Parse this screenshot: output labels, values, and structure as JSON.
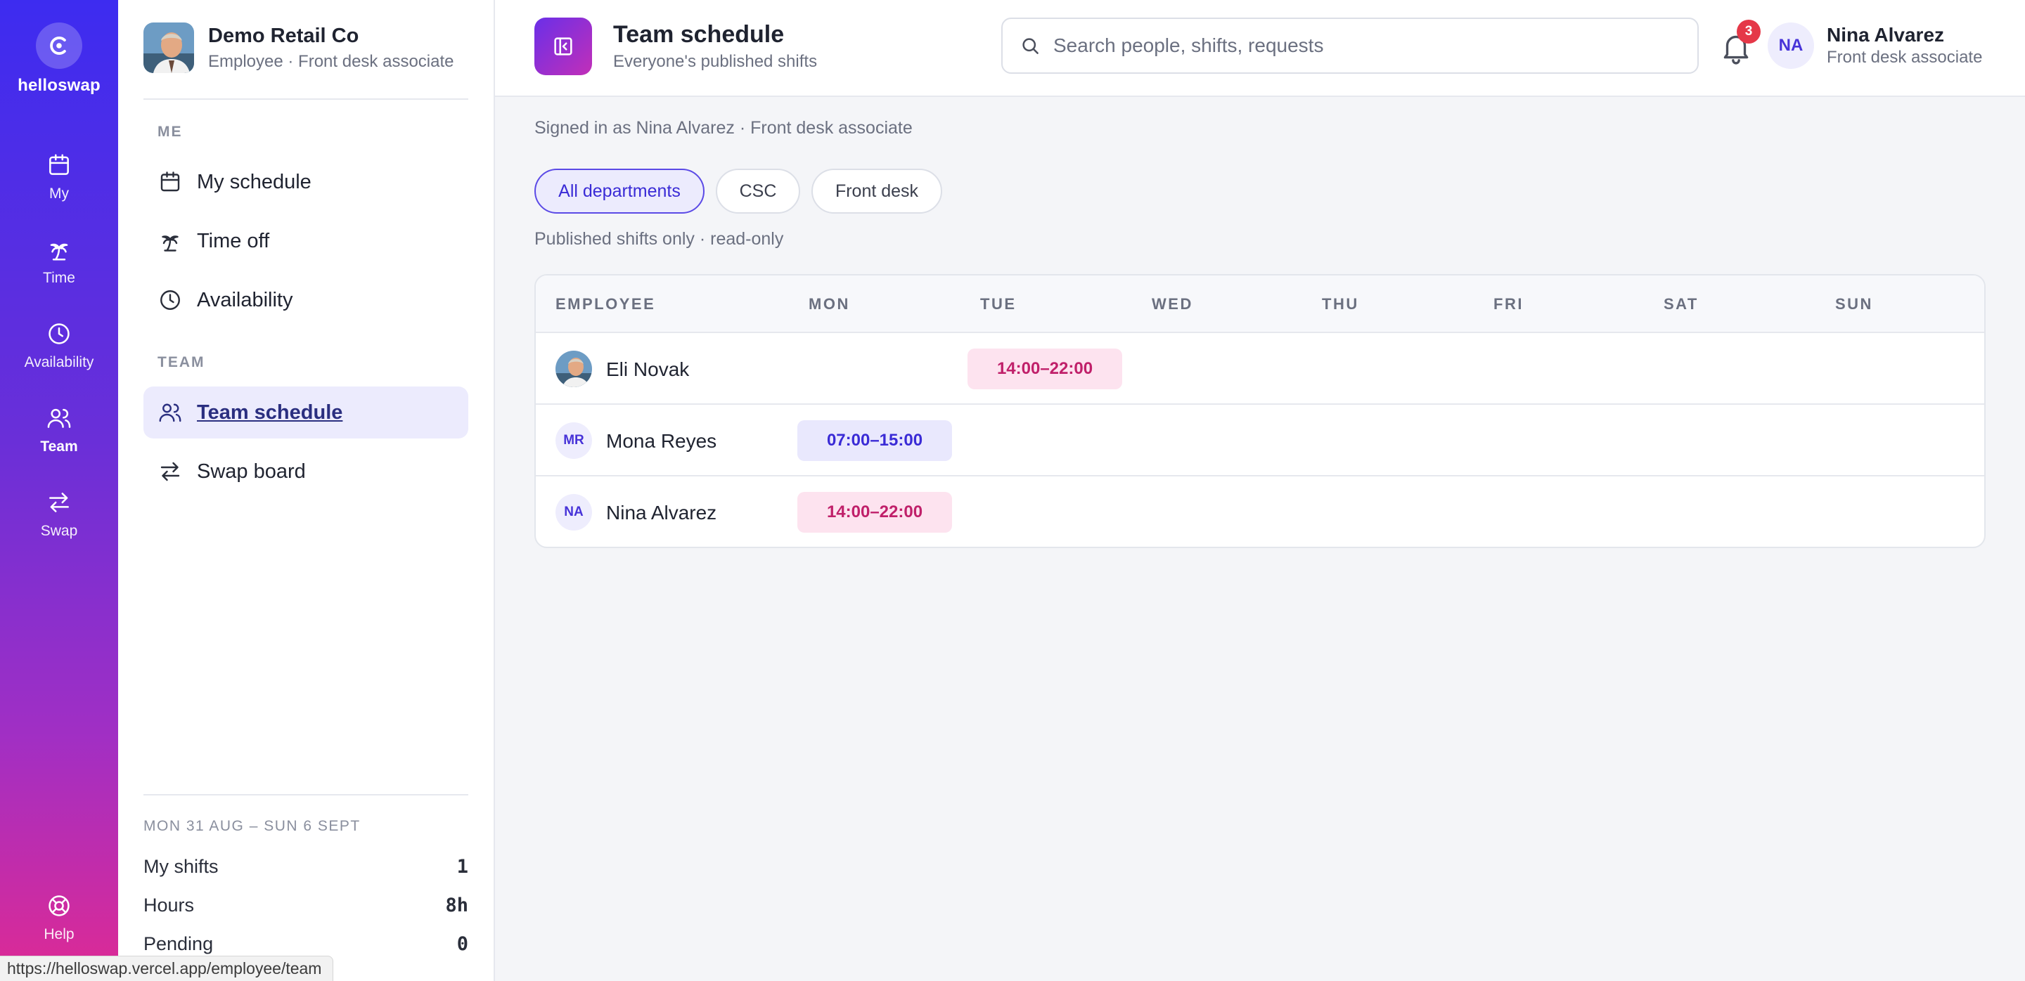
{
  "rail": {
    "brand": "helloswap",
    "items": [
      {
        "label": "My",
        "icon": "calendar-icon"
      },
      {
        "label": "Time",
        "icon": "palm-tree-icon"
      },
      {
        "label": "Availability",
        "icon": "clock-icon"
      },
      {
        "label": "Team",
        "icon": "users-icon"
      },
      {
        "label": "Swap",
        "icon": "swap-arrows-icon"
      }
    ],
    "help_label": "Help",
    "active": "Team"
  },
  "sidebar": {
    "org_name": "Demo Retail Co",
    "org_sub": "Employee · Front desk associate",
    "section_me": "ME",
    "section_team": "TEAM",
    "me_items": [
      {
        "label": "My schedule",
        "icon": "calendar-icon"
      },
      {
        "label": "Time off",
        "icon": "palm-tree-icon"
      },
      {
        "label": "Availability",
        "icon": "clock-icon"
      }
    ],
    "team_items": [
      {
        "label": "Team schedule",
        "icon": "users-icon",
        "active": true
      },
      {
        "label": "Swap board",
        "icon": "swap-arrows-icon"
      }
    ],
    "week_label": "MON 31 AUG – SUN 6 SEPT",
    "stats": [
      {
        "label": "My shifts",
        "value": "1"
      },
      {
        "label": "Hours",
        "value": "8h"
      },
      {
        "label": "Pending",
        "value": "0"
      }
    ]
  },
  "header": {
    "title": "Team schedule",
    "subtitle": "Everyone's published shifts",
    "search_placeholder": "Search people, shifts, requests",
    "notifications": "3",
    "user_initials": "NA",
    "user_name": "Nina Alvarez",
    "user_role": "Front desk associate"
  },
  "main": {
    "signed_in": "Signed in as Nina Alvarez · Front desk associate",
    "filters": [
      "All departments",
      "CSC",
      "Front desk"
    ],
    "active_filter": "All departments",
    "note": "Published shifts only · read-only",
    "columns": [
      "EMPLOYEE",
      "MON",
      "TUE",
      "WED",
      "THU",
      "FRI",
      "SAT",
      "SUN"
    ],
    "rows": [
      {
        "name": "Eli Novak",
        "initials": "",
        "photo": true,
        "shift": {
          "day": "TUE",
          "time": "14:00–22:00",
          "tone": "pink"
        }
      },
      {
        "name": "Mona Reyes",
        "initials": "MR",
        "photo": false,
        "shift": {
          "day": "MON",
          "time": "07:00–15:00",
          "tone": "blue"
        }
      },
      {
        "name": "Nina Alvarez",
        "initials": "NA",
        "photo": false,
        "shift": {
          "day": "MON",
          "time": "14:00–22:00",
          "tone": "pink"
        }
      }
    ]
  },
  "status_bar": {
    "url": "https://helloswap.vercel.app/employee/team"
  },
  "colors": {
    "accent": "#4733d8",
    "shift_pink_bg": "#fde3ef",
    "shift_pink_text": "#c0206a",
    "shift_blue_bg": "#e9e8fd",
    "badge_red": "#e53848"
  }
}
